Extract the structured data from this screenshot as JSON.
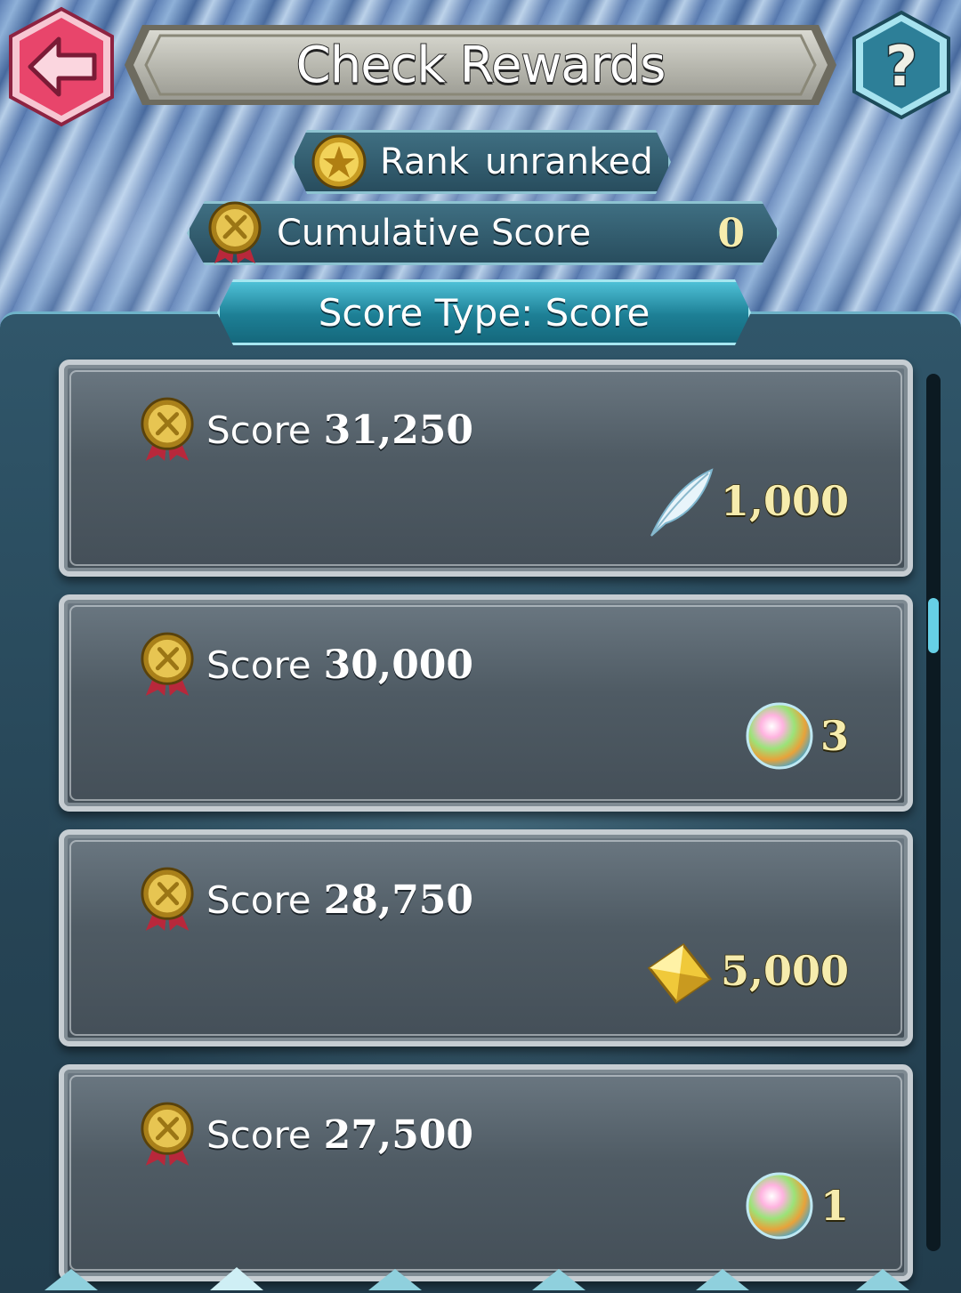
{
  "header": {
    "title": "Check Rewards",
    "back_icon": "back-arrow-icon",
    "help_icon": "help-question-icon",
    "help_glyph": "?"
  },
  "rank": {
    "prefix": "Rank",
    "value": "unranked"
  },
  "cumulative": {
    "label": "Cumulative Score",
    "value": "0"
  },
  "score_type": {
    "label": "Score Type: Score"
  },
  "rewards": [
    {
      "label": "Score",
      "score": "31,250",
      "item_icon": "feather-icon",
      "amount": "1,000"
    },
    {
      "label": "Score",
      "score": "30,000",
      "item_icon": "orb-icon",
      "amount": "3"
    },
    {
      "label": "Score",
      "score": "28,750",
      "item_icon": "gold-crystal-icon",
      "amount": "5,000"
    },
    {
      "label": "Score",
      "score": "27,500",
      "item_icon": "orb-icon",
      "amount": "1"
    }
  ],
  "colors": {
    "accent": "#4ec0d6",
    "reward_text": "#f6ecad",
    "back_button": "#e8456b"
  }
}
